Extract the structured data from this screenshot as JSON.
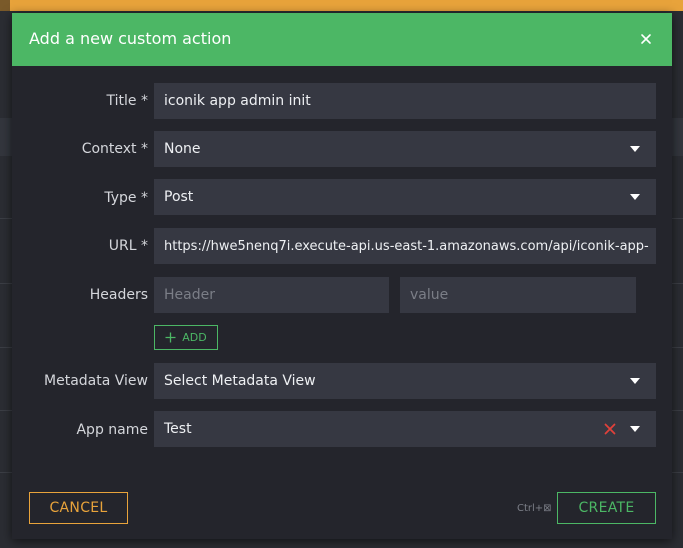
{
  "dialog": {
    "title": "Add a new custom action",
    "close_icon": "close-icon"
  },
  "form": {
    "title": {
      "label": "Title *",
      "value": "iconik app admin init"
    },
    "context": {
      "label": "Context *",
      "value": "None"
    },
    "type": {
      "label": "Type *",
      "value": "Post"
    },
    "url": {
      "label": "URL *",
      "value": "https://hwe5nenq7i.execute-api.us-east-1.amazonaws.com/api/iconik-app-"
    },
    "headers": {
      "label": "Headers",
      "header_placeholder": "Header",
      "value_placeholder": "value"
    },
    "add_button": {
      "label": "ADD",
      "icon": "plus-icon"
    },
    "metadata_view": {
      "label": "Metadata View",
      "value": "Select Metadata View"
    },
    "app_name": {
      "label": "App name",
      "value": "Test"
    }
  },
  "footer": {
    "cancel_label": "CANCEL",
    "create_label": "CREATE",
    "shortcut_hint": "Ctrl+⊠"
  },
  "colors": {
    "accent_green": "#4cb765",
    "accent_orange": "#e8a33b",
    "clear_red": "#e0413a"
  }
}
